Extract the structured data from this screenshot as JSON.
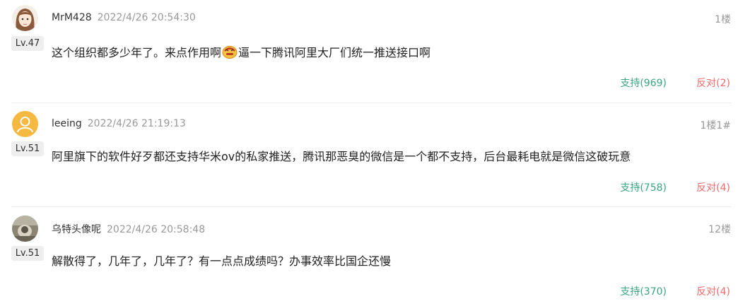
{
  "comments": [
    {
      "user": "MrM428",
      "time": "2022/4/26 20:54:30",
      "floor": "1楼",
      "level": "Lv.47",
      "content_before": "这个组织都多少年了。来点作用啊",
      "emoji": "angry-face-emoji",
      "content_after": "逼一下腾讯阿里大厂们统一推送接口啊",
      "support": "支持(969)",
      "oppose": "反对(2)"
    },
    {
      "user": "leeing",
      "time": "2022/4/26 21:19:13",
      "floor": "1楼1#",
      "level": "Lv.51",
      "content": "阿里旗下的软件好歹都还支持华米ov的私家推送，腾讯那恶臭的微信是一个都不支持，后台最耗电就是微信这破玩意",
      "support": "支持(758)",
      "oppose": "反对(4)"
    },
    {
      "user": "乌特头像呢",
      "time": "2022/4/26 20:58:48",
      "floor": "12楼",
      "level": "Lv.51",
      "content": "解散得了，几年了，几年了？有一点点成绩吗？办事效率比国企还慢",
      "support": "支持(370)",
      "oppose": "反对(4)"
    }
  ],
  "colors": {
    "support": "#3aa582",
    "oppose": "#f06a6a",
    "meta": "#999999"
  }
}
